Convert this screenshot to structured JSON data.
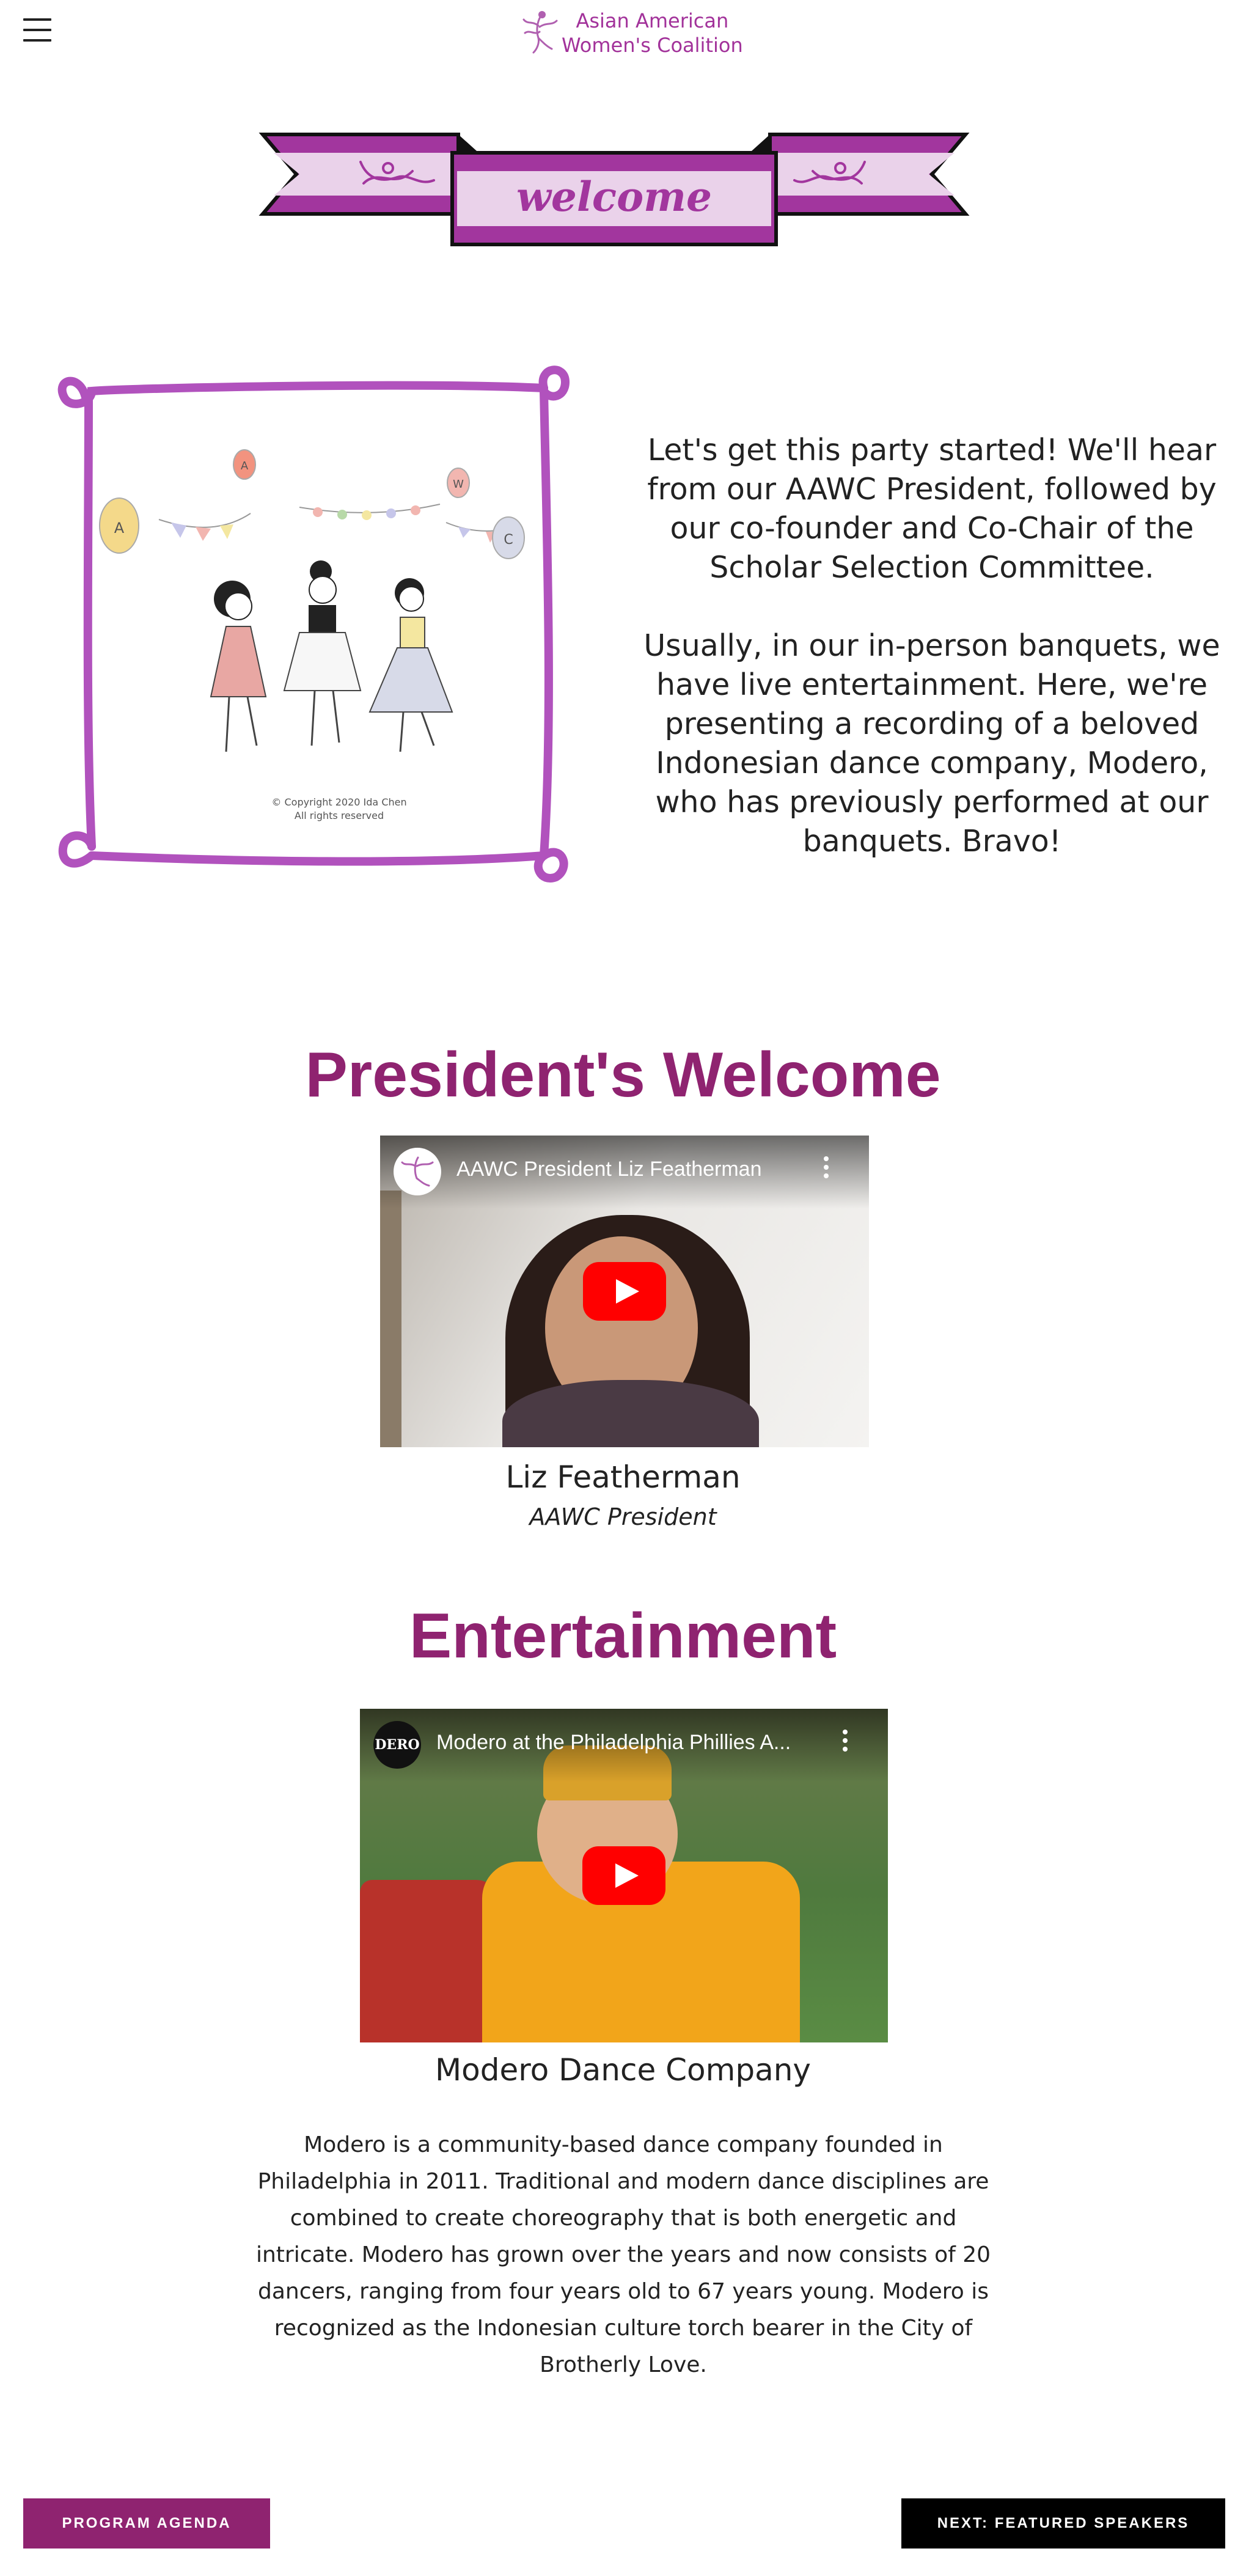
{
  "header": {
    "menu_icon": "hamburger-menu-icon",
    "logo": {
      "line1": "Asian American",
      "line2": "Women's Coalition",
      "icon": "dancer-logo-icon"
    }
  },
  "banner": {
    "text": "welcome",
    "colors": {
      "purple": "#a2369e",
      "light": "#ead2ea",
      "outline": "#111111"
    }
  },
  "illustration": {
    "copyright_line1": "© Copyright 2020 Ida Chen",
    "copyright_line2": "All rights reserved",
    "balloon_letters": [
      "A",
      "A",
      "W",
      "C"
    ]
  },
  "intro": {
    "paragraph1": "Let's get this party started!  We'll hear from our AAWC President, followed by our co-founder and Co-Chair of the Scholar Selection Committee.",
    "paragraph2": "Usually, in our in-person banquets, we have live entertainment.  Here, we're presenting a recording of a beloved Indonesian dance company, Modero, who has previously performed at our banquets. Bravo!"
  },
  "president": {
    "heading": "President's Welcome",
    "video_title": "AAWC President Liz Featherman",
    "name": "Liz Featherman",
    "role": "AAWC President"
  },
  "entertainment": {
    "heading": "Entertainment",
    "video_title": "Modero at the Philadelphia Phillies A...",
    "channel_logo_text": "DERO",
    "name": "Modero Dance Company",
    "description": "Modero is a community-based dance company founded in Philadelphia in 2011. Traditional and modern dance disciplines are combined to create choreography that is both energetic and intricate. Modero has grown over the years and now consists of 20 dancers, ranging from four years old to 67 years young. Modero is recognized as the Indonesian culture torch bearer in the City of Brotherly Love."
  },
  "footer": {
    "prev_label": "PROGRAM AGENDA",
    "next_label": "NEXT: FEATURED SPEAKERS"
  },
  "colors": {
    "accent": "#8f2370",
    "logo": "#a2329a",
    "next_button": "#000000",
    "play_button": "#ff0000"
  }
}
